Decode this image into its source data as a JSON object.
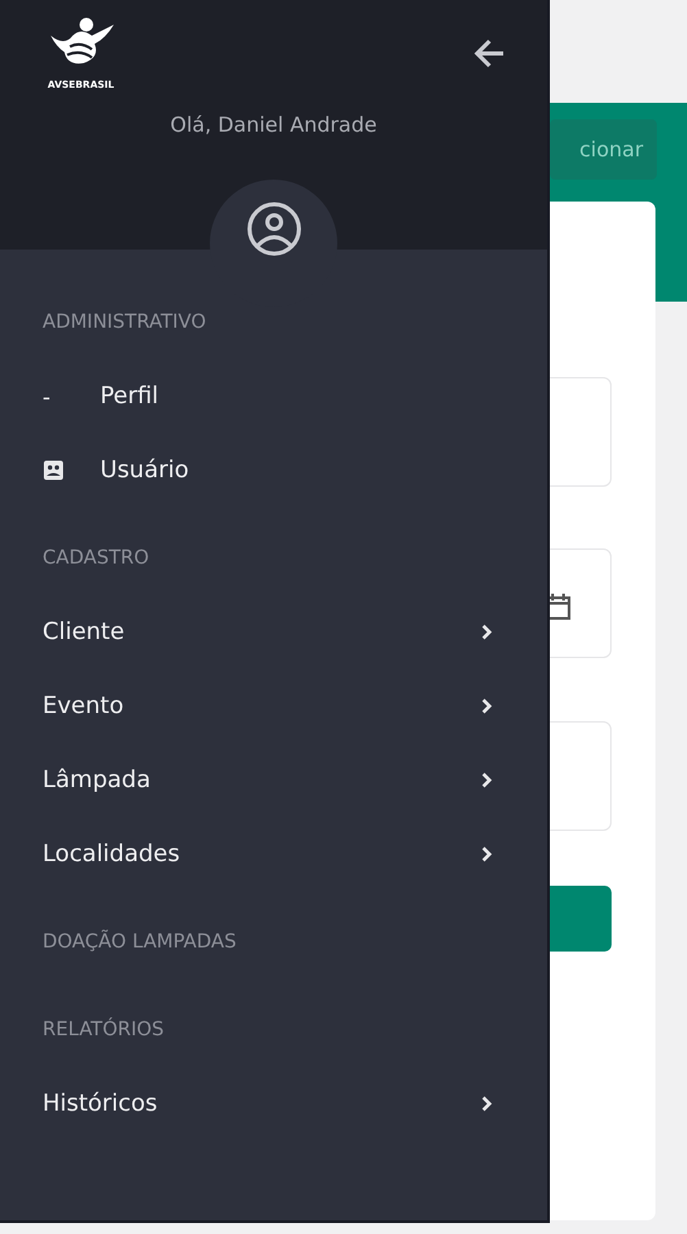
{
  "background": {
    "button_text": "cionar"
  },
  "drawer": {
    "logo_text": "AVSEBRASIL",
    "greeting": "Olá, Daniel Andrade",
    "sections": [
      {
        "title": "ADMINISTRATIVO",
        "items": [
          {
            "label": "Perfil",
            "kind": "icon",
            "icon": "-"
          },
          {
            "label": "Usuário",
            "kind": "contact"
          }
        ]
      },
      {
        "title": "CADASTRO",
        "items": [
          {
            "label": "Cliente",
            "kind": "submenu"
          },
          {
            "label": "Evento",
            "kind": "submenu"
          },
          {
            "label": "Lâmpada",
            "kind": "submenu"
          },
          {
            "label": "Localidades",
            "kind": "submenu"
          }
        ]
      },
      {
        "title": "DOAÇÃO LAMPADAS"
      },
      {
        "title": "RELATÓRIOS",
        "items": [
          {
            "label": "Históricos",
            "kind": "submenu"
          }
        ]
      }
    ]
  }
}
